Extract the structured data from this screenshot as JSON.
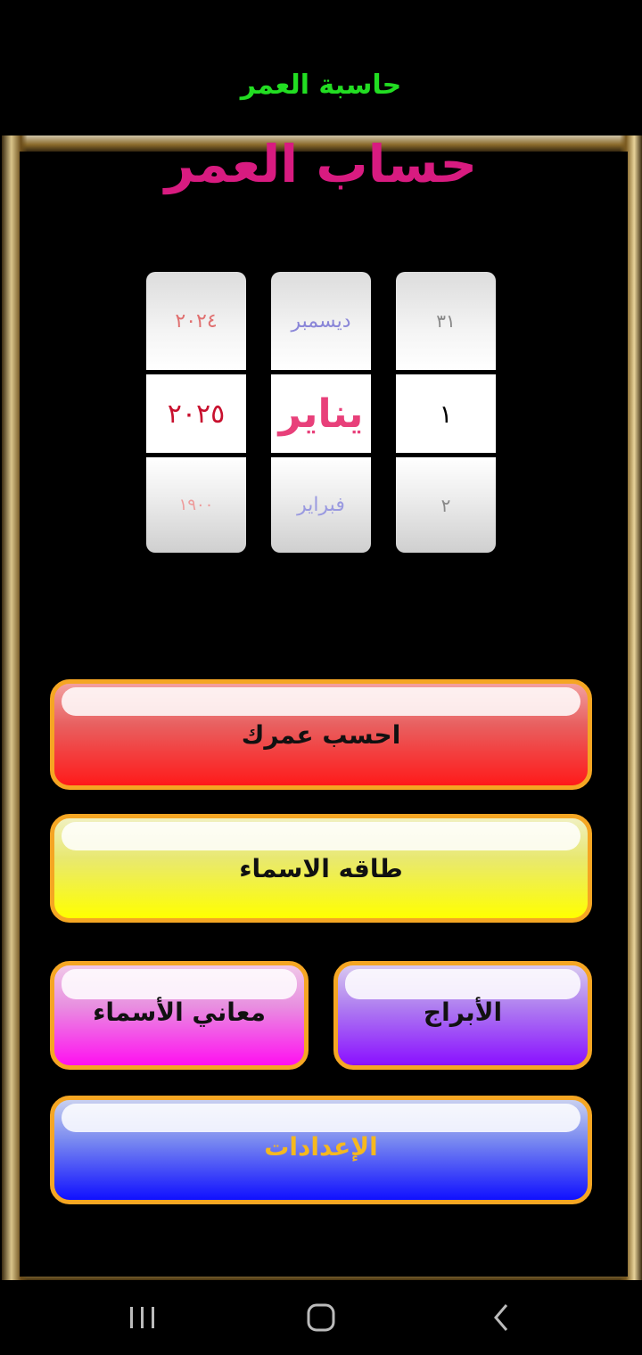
{
  "app": {
    "title": "حاسبة العمر"
  },
  "header": {
    "title": "حساب العمر"
  },
  "picker": {
    "year": {
      "prev": "٢٠٢٤",
      "selected": "٢٠٢٥",
      "next": "١٩٠٠"
    },
    "month": {
      "prev": "ديسمبر",
      "selected": "يناير",
      "next": "فبراير"
    },
    "day": {
      "prev": "٣١",
      "selected": "١",
      "next": "٢"
    }
  },
  "buttons": {
    "calculate": "احسب عمرك",
    "names_card": "طاقه الاسماء",
    "name_meanings": "معاني الأسماء",
    "horoscopes": "الأبراج",
    "settings": "الإعدادات"
  },
  "colors": {
    "appbar_title": "#22dd22",
    "main_title": "#d81b80",
    "button_border": "#f5a623",
    "settings_text": "#f5b820"
  },
  "navbar": {
    "icons": [
      "recent-apps-icon",
      "home-icon",
      "back-icon"
    ]
  }
}
